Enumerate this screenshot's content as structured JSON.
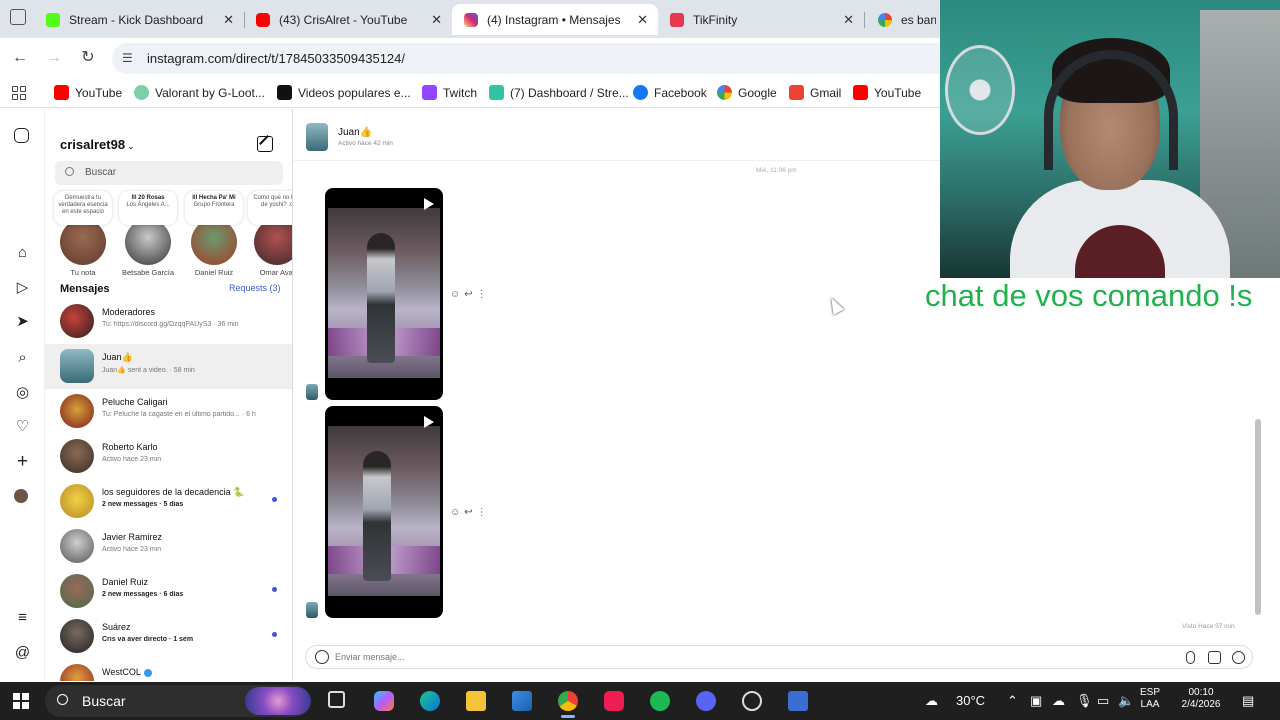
{
  "browser": {
    "tabs": [
      {
        "title": "Stream - Kick Dashboard",
        "favicon": "kick-icon",
        "color": "#53fc18",
        "active": false
      },
      {
        "title": "(43) CrisAlret - YouTube",
        "favicon": "youtube-icon",
        "color": "#ff0000",
        "active": false
      },
      {
        "title": "(4) Instagram • Mensajes",
        "favicon": "instagram-icon",
        "color": "#d6249f",
        "active": true
      },
      {
        "title": "TikFinity",
        "favicon": "tikfinity-icon",
        "color": "#e53950",
        "active": false
      },
      {
        "title": "es banea",
        "favicon": "google-icon",
        "color": "#4285f4",
        "active": false
      }
    ],
    "url": "instagram.com/direct/t/17845033509435124/",
    "bookmarks": [
      {
        "label": "YouTube",
        "icon": "youtube-icon",
        "color": "#ff0000"
      },
      {
        "label": "Valorant by G-Loot...",
        "icon": "gloot-icon",
        "color": "#7ad1a8"
      },
      {
        "label": "Videos populares e...",
        "icon": "tiktok-icon",
        "color": "#111111"
      },
      {
        "label": "Twitch",
        "icon": "twitch-icon",
        "color": "#9146ff"
      },
      {
        "label": "(7) Dashboard / Stre...",
        "icon": "streamlabs-icon",
        "color": "#31c3a2"
      },
      {
        "label": "Facebook",
        "icon": "facebook-icon",
        "color": "#1877f2"
      },
      {
        "label": "Google",
        "icon": "google-icon",
        "color": "#4285f4"
      },
      {
        "label": "Gmail",
        "icon": "gmail-icon",
        "color": "#ea4335"
      },
      {
        "label": "YouTube",
        "icon": "youtube-icon",
        "color": "#ff0000"
      }
    ]
  },
  "inbox": {
    "username": "crisalret98",
    "search_placeholder": "Buscar",
    "notes": [
      {
        "bubble": "Demuestra tu verdadera esencia en este espacio",
        "bubble_title": "",
        "name": "Tu nota"
      },
      {
        "bubble": "Los Ángeles A...",
        "bubble_title": "lll 20 Rosas",
        "name": "Betsabe García"
      },
      {
        "bubble": "Grupo Frontera",
        "bubble_title": "lll Hecha Pa' Mi",
        "name": "Daniel Ruiz"
      },
      {
        "bubble": "Como que no hay de yoshi? :c",
        "bubble_title": "",
        "name": "Omar Aval"
      }
    ],
    "section_title": "Mensajes",
    "requests": "Requests (3)",
    "conversations": [
      {
        "name": "Moderadores",
        "preview": "Tu: https://discord.gg/DzqqPAUyS3 · 36 min",
        "unread": false,
        "selected": false
      },
      {
        "name": "Juan👍",
        "preview": "Juan👍 sent a video. · 58 min",
        "unread": false,
        "selected": true
      },
      {
        "name": "Peluche Caligari",
        "preview": "Tu: Peluche la cagaste en el último partido... · 6 h",
        "unread": false,
        "selected": false
      },
      {
        "name": "Roberto Karlo",
        "preview": "Activo hace 23 min",
        "unread": false,
        "selected": false
      },
      {
        "name": "los seguidores de la decadencia 🐍",
        "preview": "2 new messages · 5 días",
        "unread": true,
        "selected": false
      },
      {
        "name": "Javier Ramirez",
        "preview": "Activo hace 23 min",
        "unread": false,
        "selected": false
      },
      {
        "name": "Daniel Ruiz",
        "preview": "2 new messages · 6 días",
        "unread": true,
        "selected": false
      },
      {
        "name": "Suárez",
        "preview": "Cris va aver directo · 1 sem",
        "unread": true,
        "selected": false
      },
      {
        "name": "WestCOL",
        "preview": "",
        "unread": false,
        "selected": false
      }
    ]
  },
  "chat": {
    "contact_name": "Juan👍",
    "contact_status": "Activo hace 42 min",
    "day_label": "Mié, 11:06 pm",
    "seen_label": "Visto Hace 57 min",
    "composer_placeholder": "Enviar mensaje..."
  },
  "overlay_text": "chat de vos comando !s",
  "taskbar": {
    "search_placeholder": "Buscar",
    "weather": "30°C",
    "language_top": "ESP",
    "language_bottom": "LAA",
    "time": "00:10",
    "date": "2/4/2026"
  }
}
